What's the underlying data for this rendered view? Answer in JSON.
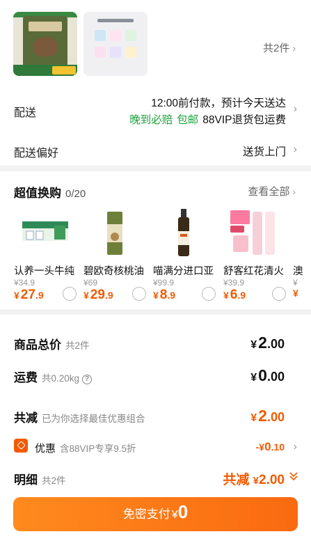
{
  "products": {
    "thumb1_alt": "Instinct ORIGINAL",
    "count_label": "共2件"
  },
  "delivery": {
    "label": "配送",
    "line1": "12:00前付款，预计今天送达",
    "late_pay": "晚到必赔",
    "free_ship": "包邮",
    "vip_return": "88VIP退货包运费"
  },
  "delivery_pref": {
    "label": "配送偏好",
    "value": "送货上门"
  },
  "deals": {
    "title": "超值换购",
    "count": "0/20",
    "see_all": "查看全部",
    "items": [
      {
        "name": "认养一头牛纯",
        "orig": "¥34.9",
        "yen": "¥",
        "int": "27",
        "dec": ".9"
      },
      {
        "name": "碧欧奇核桃油",
        "orig": "¥69",
        "yen": "¥",
        "int": "29",
        "dec": ".9"
      },
      {
        "name": "喵满分进口亚",
        "orig": "¥99.9",
        "yen": "¥",
        "int": "8",
        "dec": ".9"
      },
      {
        "name": "舒客红花清火",
        "orig": "¥39.9",
        "yen": "¥",
        "int": "6",
        "dec": ".9"
      },
      {
        "name": "澳",
        "orig": "¥",
        "yen": "¥",
        "int": "",
        "dec": ""
      }
    ]
  },
  "summary": {
    "total_label": "商品总价",
    "total_sub": "共2件",
    "total_yen": "¥",
    "total_int": "2",
    "total_dec": ".00",
    "shipping_label": "运费",
    "shipping_sub": "共0.20kg",
    "shipping_help": "?",
    "shipping_yen": "¥",
    "shipping_int": "0",
    "shipping_dec": ".00",
    "discount_label": "共减",
    "discount_sub": "已为你选择最佳优惠组合",
    "discount_yen": "¥",
    "discount_int": "2",
    "discount_dec": ".00",
    "coupon_label": "优惠",
    "coupon_sub": "含88VIP专享9.5折",
    "coupon_yen": "-¥",
    "coupon_int": "0",
    "coupon_dec": ".10",
    "detail_label": "明细",
    "detail_sub": "共2件",
    "detail_value_prefix": "共减",
    "detail_yen": "¥",
    "detail_amount": "2.00"
  },
  "pay_button": {
    "label": "免密支付",
    "yen": "¥",
    "amount": "0"
  },
  "colors": {
    "accent": "#f25a00",
    "green": "#1aa33a",
    "button_start": "#ff8a1e",
    "button_end": "#fa6a10"
  }
}
